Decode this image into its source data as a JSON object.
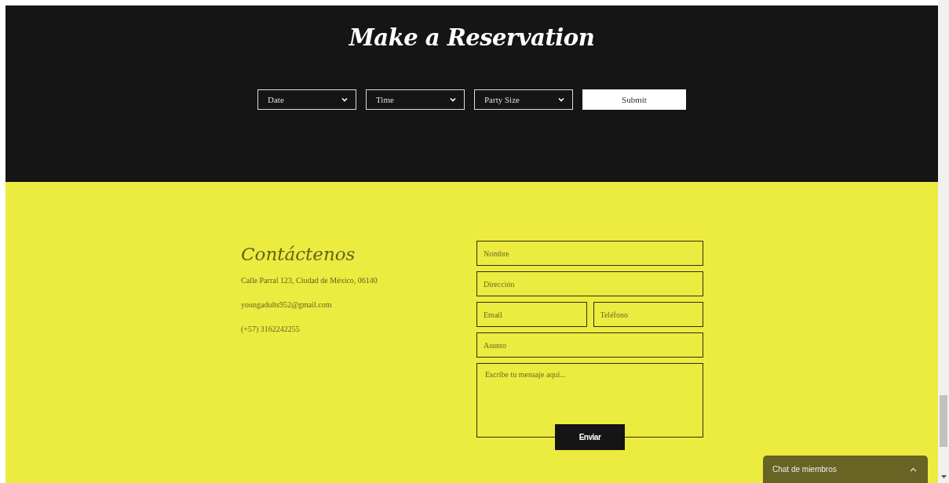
{
  "reservation": {
    "title": "Make a Reservation",
    "selects": [
      {
        "placeholder": "Date"
      },
      {
        "placeholder": "Time"
      },
      {
        "placeholder": "Party Size"
      }
    ],
    "submit": "Submit"
  },
  "contact": {
    "title": "Contáctenos",
    "lines": [
      "Calle Parral 123, Ciudad de México, 06140",
      "youngadults952@gmail.com",
      "(+57) 3162242255"
    ],
    "fields": [
      {
        "placeholder": "Nombre",
        "kind": "full"
      },
      {
        "placeholder": "Dirección",
        "kind": "full"
      },
      {
        "placeholder": "Email",
        "kind": "half"
      },
      {
        "placeholder": "Teléfono",
        "kind": "half"
      },
      {
        "placeholder": "Asunto",
        "kind": "full"
      },
      {
        "placeholder": "Escribe tu mensaje aquí...",
        "kind": "message"
      }
    ],
    "send": "Enviar"
  },
  "chat": {
    "label": "Chat de miembros"
  }
}
